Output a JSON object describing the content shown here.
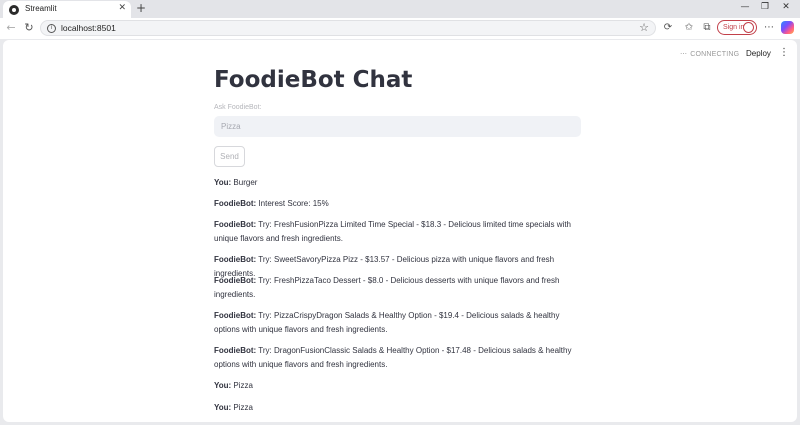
{
  "browser": {
    "tab_title": "Streamlit",
    "url": "localhost:8501",
    "signin_label": "Sign in"
  },
  "app": {
    "status": "CONNECTING",
    "deploy_label": "Deploy",
    "title": "FoodieBot Chat",
    "input_label": "Ask FoodieBot:",
    "input_value": "Pizza",
    "send_label": "Send"
  },
  "messages": [
    {
      "speaker": "You:",
      "text": "Burger"
    },
    {
      "speaker": "FoodieBot:",
      "text": "Interest Score: 15%"
    },
    {
      "speaker": "FoodieBot:",
      "text": "Try: FreshFusionPizza Limited Time Special - $18.3 - Delicious limited time specials with unique flavors and fresh ingredients."
    },
    {
      "speaker": "FoodieBot:",
      "text": "Try: SweetSavoryPizza Pizz - $13.57 - Delicious pizza with unique flavors and fresh ingredients."
    },
    {
      "speaker": "FoodieBot:",
      "text": "Try: FreshPizzaTaco Dessert - $8.0 - Delicious desserts with unique flavors and fresh ingredients."
    },
    {
      "speaker": "FoodieBot:",
      "text": "Try: PizzaCrispyDragon Salads & Healthy Option - $19.4 - Delicious salads & healthy options with unique flavors and fresh ingredients."
    },
    {
      "speaker": "FoodieBot:",
      "text": "Try: DragonFusionClassic Salads & Healthy Option - $17.48 - Delicious salads & healthy options with unique flavors and fresh ingredients."
    },
    {
      "speaker": "You:",
      "text": "Pizza"
    },
    {
      "speaker": "You:",
      "text": "Pizza"
    }
  ]
}
